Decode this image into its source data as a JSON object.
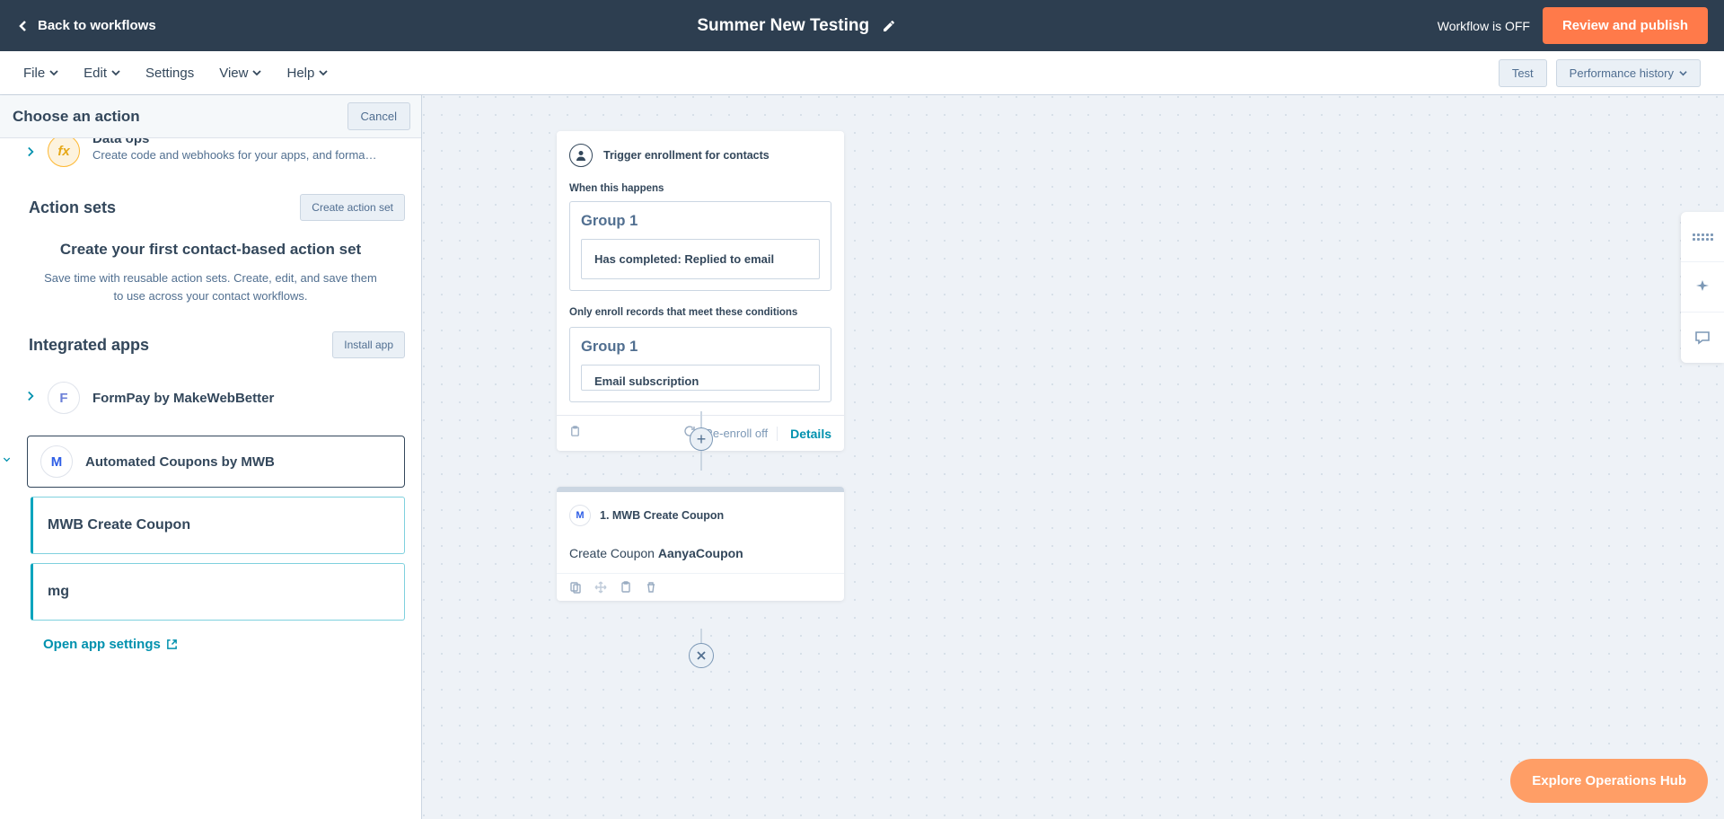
{
  "topbar": {
    "back": "Back to workflows",
    "title": "Summer New Testing",
    "status": "Workflow is OFF",
    "review": "Review and publish"
  },
  "menubar": {
    "file": "File",
    "edit": "Edit",
    "settings": "Settings",
    "view": "View",
    "help": "Help",
    "test": "Test",
    "history": "Performance history"
  },
  "panel": {
    "title": "Choose an action",
    "cancel": "Cancel",
    "dataops": {
      "title": "Data ops",
      "desc": "Create code and webhooks for your apps, and format …"
    },
    "actionsets": {
      "title": "Action sets",
      "create_btn": "Create action set",
      "headline": "Create your first contact-based action set",
      "desc": "Save time with reusable action sets. Create, edit, and save them to use across your contact workflows."
    },
    "integrated": {
      "title": "Integrated apps",
      "install_btn": "Install app"
    },
    "apps": {
      "formpay": "FormPay by MakeWebBetter",
      "autocoupons": "Automated Coupons by MWB"
    },
    "actions": {
      "create_coupon": "MWB Create Coupon",
      "mg": "mg"
    },
    "open_settings": "Open app settings"
  },
  "trigger": {
    "title": "Trigger enrollment for contacts",
    "when_label": "When this happens",
    "group1": "Group 1",
    "cond1": "Has completed: Replied to email",
    "only_label": "Only enroll records that meet these conditions",
    "cond2": "Email subscription",
    "reenroll": "Re-enroll off",
    "details": "Details"
  },
  "actioncard": {
    "title": "1. MWB Create Coupon",
    "body_pre": "Create Coupon ",
    "body_bold": "AanyaCoupon"
  },
  "explore": "Explore Operations Hub"
}
